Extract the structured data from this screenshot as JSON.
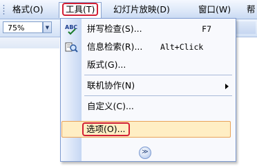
{
  "menubar": {
    "items": [
      {
        "label": "格式(O)"
      },
      {
        "label": "工具(T)"
      },
      {
        "label": "幻灯片放映(D)"
      },
      {
        "label": "窗口(W)"
      },
      {
        "label": "帮"
      }
    ]
  },
  "toolbar": {
    "zoom": "75%",
    "zoom_dropdown_glyph": "▼"
  },
  "tools_menu": {
    "items": [
      {
        "label": "拼写检查(S)...",
        "shortcut": "F7",
        "icon": "spelling-icon"
      },
      {
        "label": "信息检索(R)...",
        "shortcut": "Alt+Click",
        "icon": "research-icon"
      },
      {
        "label": "版式(G)..."
      },
      {
        "label": "联机协作(N)",
        "submenu": true
      },
      {
        "label": "自定义(C)..."
      },
      {
        "label": "选项(O)...",
        "highlighted": true
      }
    ],
    "expand_glyph": "≫"
  },
  "colors": {
    "highlight_fill": "#ffeec4",
    "highlight_border": "#e9a25a",
    "annotation_red": "#d21f34",
    "menubar_bg": "#dce7f8"
  }
}
